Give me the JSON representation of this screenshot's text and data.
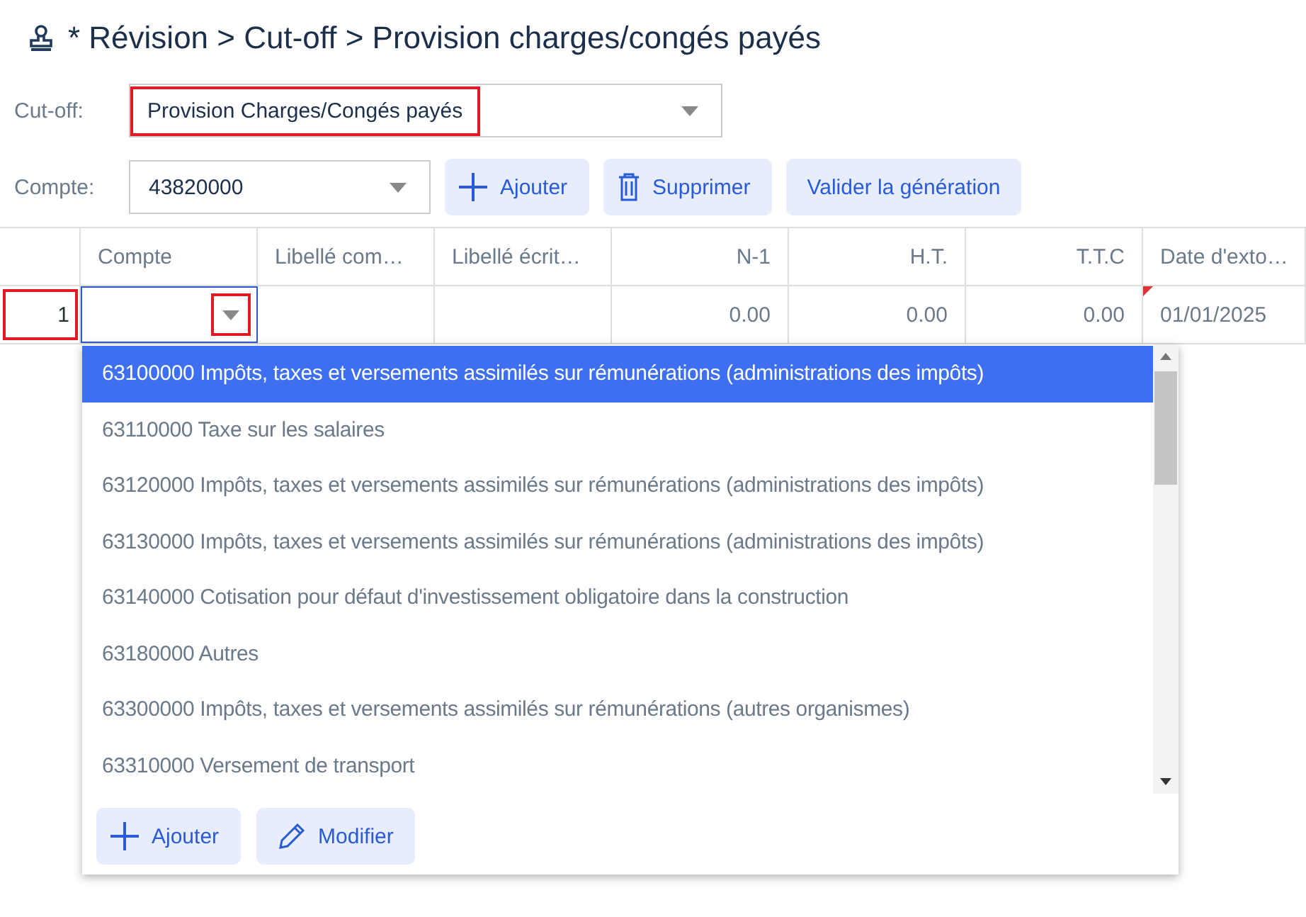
{
  "title": "* Révision > Cut-off > Provision charges/congés payés",
  "cutoff": {
    "label": "Cut-off:",
    "value": "Provision Charges/Congés payés",
    "highlighted": true
  },
  "compte": {
    "label": "Compte:",
    "value": "43820000"
  },
  "buttons": [
    {
      "label": "Ajouter"
    },
    {
      "label": "Supprimer"
    },
    {
      "label": "Valider la génération"
    }
  ],
  "table": {
    "columns": [
      {
        "label": "Compte"
      },
      {
        "label": "Libellé com…"
      },
      {
        "label": "Libellé écrit…"
      },
      {
        "label": "N-1"
      },
      {
        "label": "H.T."
      },
      {
        "label": "T.T.C"
      },
      {
        "label": "Date d'exto…"
      }
    ],
    "rows": [
      {
        "number": "1",
        "number_highlighted": true,
        "caret_highlighted": true,
        "cells": [
          "",
          "",
          "",
          "0.00",
          "0.00",
          "0.00",
          "01/01/2025"
        ]
      }
    ]
  },
  "dropdown": {
    "items": [
      {
        "label": "63100000 Impôts, taxes et versements assimilés sur rémunérations (administrations des impôts)",
        "selected": true
      },
      {
        "label": "63110000 Taxe sur les salaires",
        "selected": false
      },
      {
        "label": "63120000 Impôts, taxes et versements assimilés sur rémunérations (administrations des impôts)",
        "selected": false
      },
      {
        "label": "63130000 Impôts, taxes et versements assimilés sur rémunérations (administrations des impôts)",
        "selected": false
      },
      {
        "label": "63140000 Cotisation pour défaut d'investissement obligatoire dans la construction",
        "selected": false
      },
      {
        "label": "63180000 Autres",
        "selected": false
      },
      {
        "label": "63300000 Impôts, taxes et versements assimilés sur rémunérations (autres organismes)",
        "selected": false
      },
      {
        "label": "63310000 Versement de transport",
        "selected": false
      }
    ],
    "buttons": [
      {
        "label": "Ajouter"
      },
      {
        "label": "Modifier"
      }
    ]
  }
}
